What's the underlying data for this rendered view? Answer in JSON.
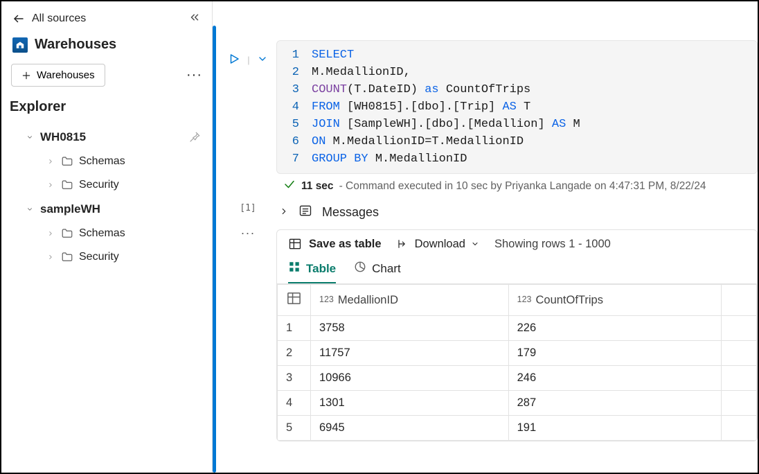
{
  "sidebar": {
    "back_label": "All sources",
    "section_title": "Warehouses",
    "add_button_label": "Warehouses",
    "explorer_title": "Explorer",
    "tree": [
      {
        "name": "WH0815",
        "expanded": true,
        "children": [
          "Schemas",
          "Security"
        ],
        "pinned": true
      },
      {
        "name": "sampleWH",
        "expanded": true,
        "children": [
          "Schemas",
          "Security"
        ],
        "pinned": false
      }
    ]
  },
  "editor": {
    "lines": [
      [
        {
          "t": "SELECT",
          "cls": "kw"
        }
      ],
      [
        {
          "t": "M.MedallionID,",
          "cls": "id"
        }
      ],
      [
        {
          "t": "COUNT",
          "cls": "fn"
        },
        {
          "t": "(T.DateID) ",
          "cls": "id"
        },
        {
          "t": "as",
          "cls": "kw"
        },
        {
          "t": " CountOfTrips",
          "cls": "id"
        }
      ],
      [
        {
          "t": "FROM",
          "cls": "kw"
        },
        {
          "t": " [WH0815].[dbo].[Trip] ",
          "cls": "id"
        },
        {
          "t": "AS",
          "cls": "kw"
        },
        {
          "t": " T",
          "cls": "id"
        }
      ],
      [
        {
          "t": "JOIN",
          "cls": "kw"
        },
        {
          "t": " [SampleWH].[dbo].[Medallion] ",
          "cls": "id"
        },
        {
          "t": "AS",
          "cls": "kw"
        },
        {
          "t": " M",
          "cls": "id"
        }
      ],
      [
        {
          "t": "ON",
          "cls": "kw"
        },
        {
          "t": " M.MedallionID=T.MedallionID",
          "cls": "id"
        }
      ],
      [
        {
          "t": "GROUP BY",
          "cls": "kw"
        },
        {
          "t": " M.MedallionID",
          "cls": "id"
        }
      ]
    ],
    "cell_ref": "[1]"
  },
  "status": {
    "duration": "11 sec",
    "message": " - Command executed in 10 sec by Priyanka Langade on 4:47:31 PM, 8/22/24"
  },
  "messages_label": "Messages",
  "results": {
    "save_label": "Save as table",
    "download_label": "Download",
    "showing_label": "Showing rows 1 - 1000",
    "tabs": {
      "table": "Table",
      "chart": "Chart"
    },
    "columns": [
      {
        "name": "MedallionID",
        "type": "123"
      },
      {
        "name": "CountOfTrips",
        "type": "123"
      }
    ],
    "rows": [
      {
        "n": "1",
        "MedallionID": "3758",
        "CountOfTrips": "226"
      },
      {
        "n": "2",
        "MedallionID": "11757",
        "CountOfTrips": "179"
      },
      {
        "n": "3",
        "MedallionID": "10966",
        "CountOfTrips": "246"
      },
      {
        "n": "4",
        "MedallionID": "1301",
        "CountOfTrips": "287"
      },
      {
        "n": "5",
        "MedallionID": "6945",
        "CountOfTrips": "191"
      }
    ]
  }
}
